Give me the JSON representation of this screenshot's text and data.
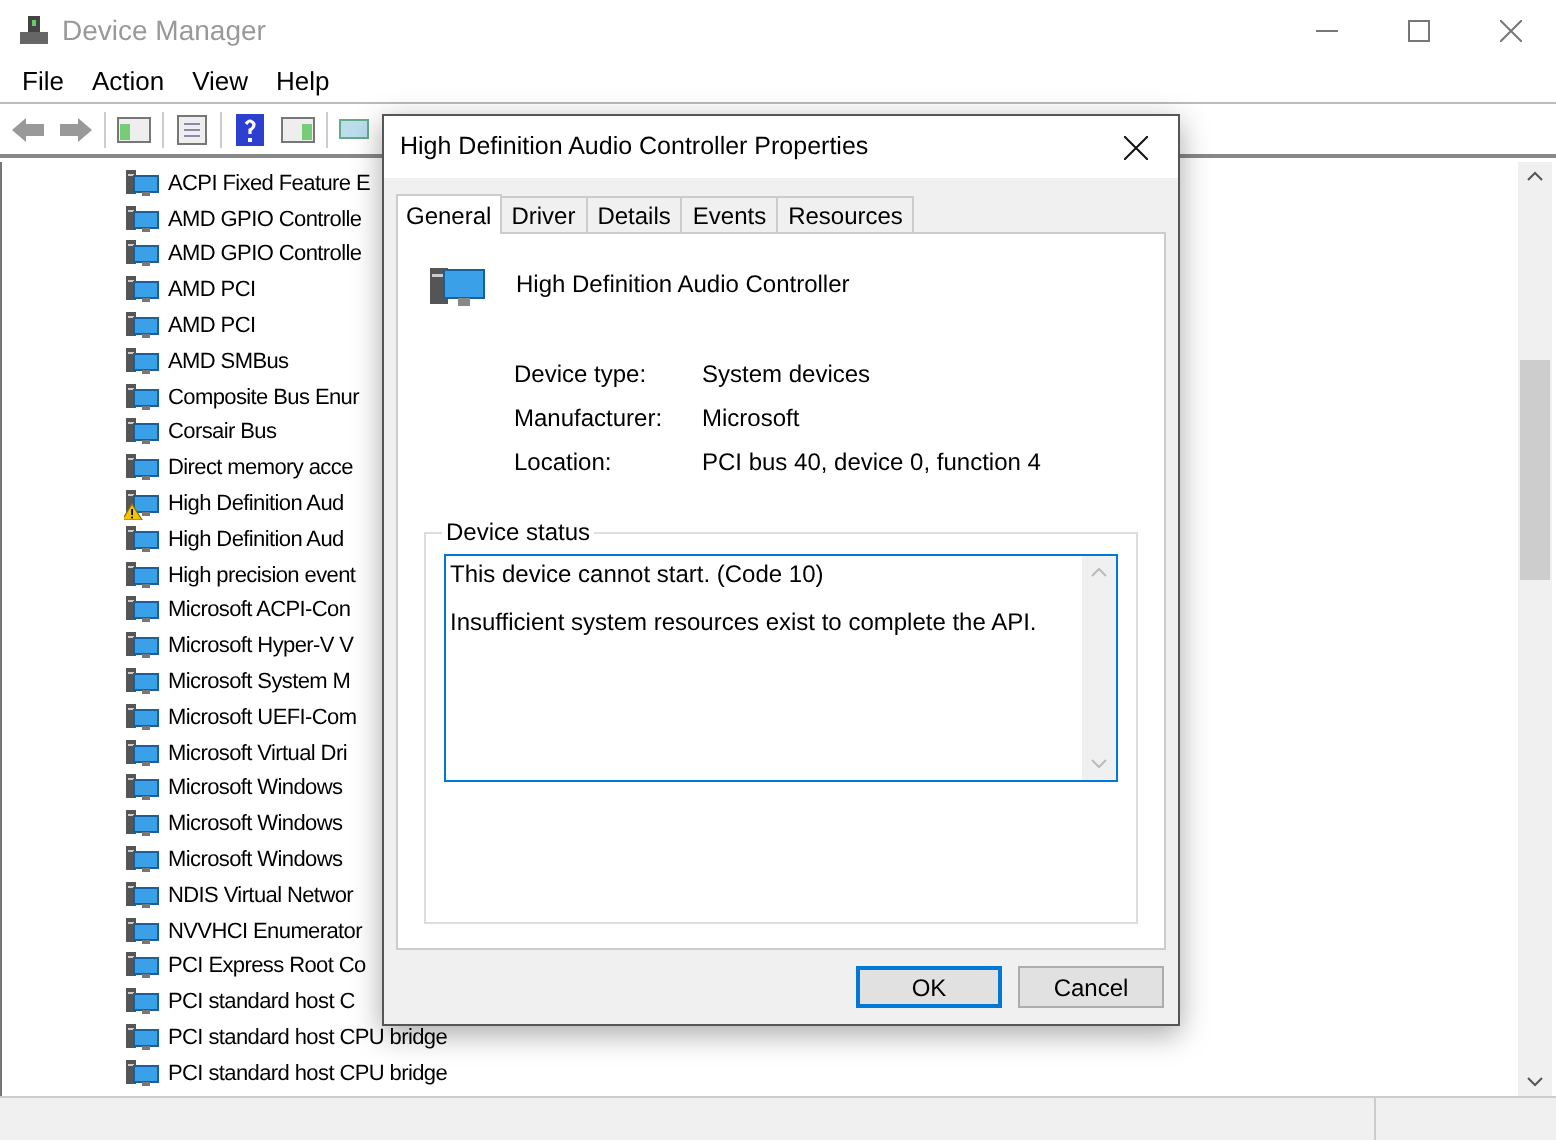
{
  "window": {
    "title": "Device Manager"
  },
  "menu": [
    "File",
    "Action",
    "View",
    "Help"
  ],
  "tree": [
    {
      "label": "ACPI Fixed Feature E",
      "warning": false
    },
    {
      "label": "AMD GPIO Controlle",
      "warning": false
    },
    {
      "label": "AMD GPIO Controlle",
      "warning": false
    },
    {
      "label": "AMD PCI",
      "warning": false
    },
    {
      "label": "AMD PCI",
      "warning": false
    },
    {
      "label": "AMD SMBus",
      "warning": false
    },
    {
      "label": "Composite Bus Enur",
      "warning": false
    },
    {
      "label": "Corsair Bus",
      "warning": false
    },
    {
      "label": "Direct memory acce",
      "warning": false
    },
    {
      "label": "High Definition Aud",
      "warning": true
    },
    {
      "label": "High Definition Aud",
      "warning": false
    },
    {
      "label": "High precision event",
      "warning": false
    },
    {
      "label": "Microsoft ACPI-Con",
      "warning": false
    },
    {
      "label": "Microsoft Hyper-V V",
      "warning": false
    },
    {
      "label": "Microsoft System M",
      "warning": false
    },
    {
      "label": "Microsoft UEFI-Com",
      "warning": false
    },
    {
      "label": "Microsoft Virtual Dri",
      "warning": false
    },
    {
      "label": "Microsoft Windows",
      "warning": false
    },
    {
      "label": "Microsoft Windows",
      "warning": false
    },
    {
      "label": "Microsoft Windows",
      "warning": false
    },
    {
      "label": "NDIS Virtual Networ",
      "warning": false
    },
    {
      "label": "NVVHCI Enumerator",
      "warning": false
    },
    {
      "label": "PCI Express Root Co",
      "warning": false
    },
    {
      "label": "PCI standard host C",
      "warning": false
    },
    {
      "label": "PCI standard host CPU bridge",
      "warning": false
    },
    {
      "label": "PCI standard host CPU bridge",
      "warning": false
    }
  ],
  "dialog": {
    "title": "High Definition Audio Controller Properties",
    "tabs": [
      {
        "label": "General",
        "selected": true
      },
      {
        "label": "Driver",
        "selected": false
      },
      {
        "label": "Details",
        "selected": false
      },
      {
        "label": "Events",
        "selected": false
      },
      {
        "label": "Resources",
        "selected": false
      }
    ],
    "device_name": "High Definition Audio Controller",
    "properties": [
      {
        "label": "Device type:",
        "value": "System devices"
      },
      {
        "label": "Manufacturer:",
        "value": "Microsoft"
      },
      {
        "label": "Location:",
        "value": "PCI bus 40, device 0, function 4"
      }
    ],
    "status_group": {
      "title": "Device status",
      "lines": [
        "This device cannot start. (Code 10)",
        "Insufficient system resources exist to complete the API."
      ]
    },
    "buttons": [
      {
        "label": "OK",
        "default": true
      },
      {
        "label": "Cancel",
        "default": false
      }
    ]
  }
}
